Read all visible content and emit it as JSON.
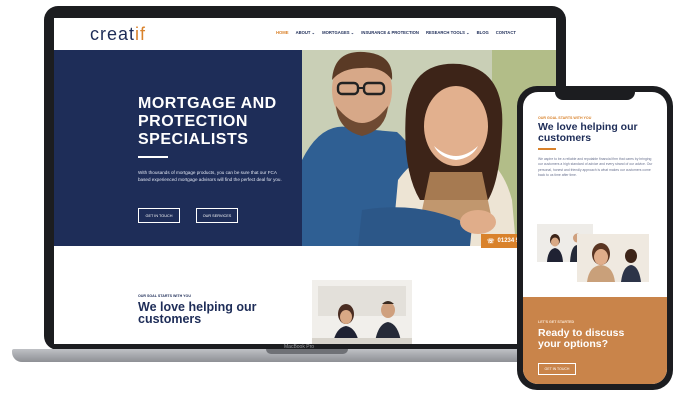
{
  "site": {
    "logo_main": "creat",
    "logo_accent": "if"
  },
  "nav": {
    "items": [
      "HOME",
      "ABOUT ⌄",
      "MORTGAGES ⌄",
      "INSURANCE & PROTECTION",
      "RESEARCH TOOLS ⌄",
      "BLOG",
      "CONTACT"
    ],
    "active_index": 0
  },
  "hero": {
    "title": "MORTGAGE AND PROTECTION SPECIALISTS",
    "body": "With thousands of mortgage products, you can be sure that our FCA based experienced mortgage advisors will find the perfect deal for you.",
    "button_primary": "GET IN TOUCH",
    "button_secondary": "OUR SERVICES",
    "phone": "01234 5"
  },
  "section": {
    "tag": "OUR SOAL STARTS WITH YOU",
    "title": "We love helping our customers"
  },
  "laptop": {
    "label": "MacBook Pro"
  },
  "mobile": {
    "tag": "OUR GOAL STARTS WITH YOU",
    "title": "We love helping our customers",
    "body": "We aspire to be a reliable and reputable financial firm that cares by bringing our customers a high standard of advice and every strand of our advice. Our personal, honest and friendly approach is what makes our customers come back to us time after time.",
    "cta_tag": "LET'S GET STARTED",
    "cta_title": "Ready to discuss your options?",
    "cta_button": "GET IN TOUCH"
  },
  "colors": {
    "navy": "#1e2d58",
    "orange": "#d9822b",
    "orange_panel": "#c9844a"
  }
}
